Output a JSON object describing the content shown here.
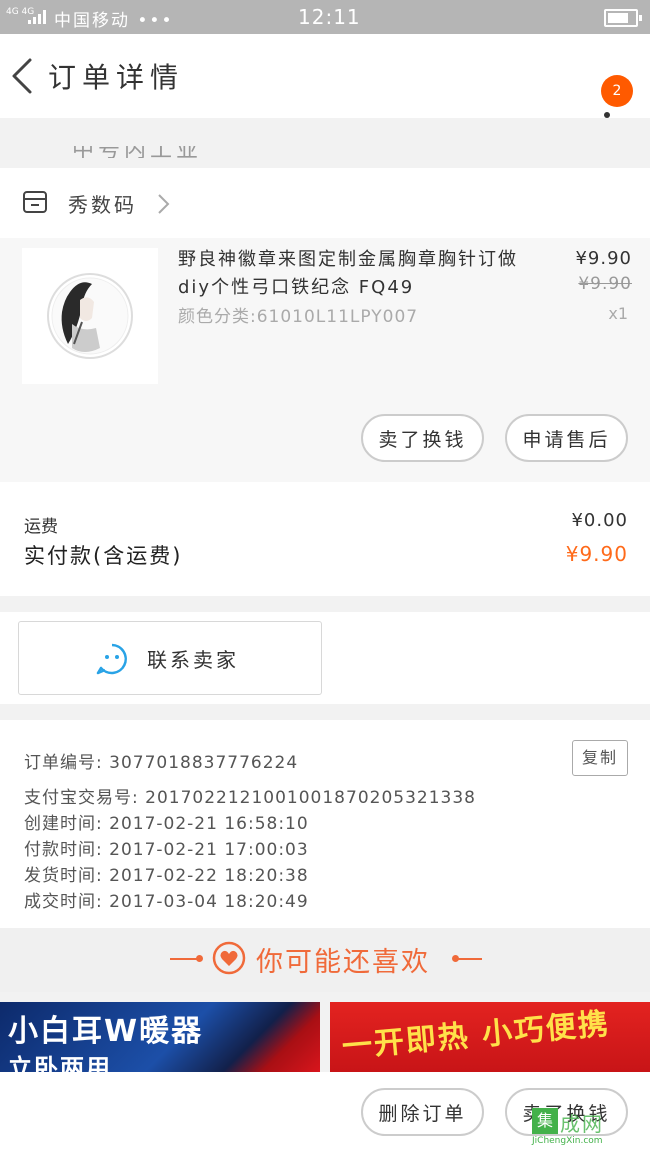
{
  "status_bar": {
    "network": "4G 4G",
    "carrier": "中国移动 •••",
    "time": "12:11"
  },
  "header": {
    "title": "订单详情",
    "badge_count": "2",
    "obscured_text": "中号内工业"
  },
  "store": {
    "name": "秀数码"
  },
  "product": {
    "title": "野良神徽章来图定制金属胸章胸针订做diy个性弓口铁纪念 FQ49",
    "variant": "颜色分类:61010L11LPY007",
    "price": "¥9.90",
    "original_price": "¥9.90",
    "quantity": "x1",
    "buttons": {
      "sell_swap": "卖了换钱",
      "after_sale": "申请售后"
    }
  },
  "totals": {
    "shipping_label": "运费",
    "shipping_value": "¥0.00",
    "paid_label": "实付款(含运费)",
    "paid_value": "¥9.90"
  },
  "contact": {
    "label": "联系卖家"
  },
  "order_info": {
    "order_no": "订单编号: 3077018837776224",
    "alipay_no": "支付宝交易号: 2017022121001001870205321338",
    "created": "创建时间: 2017-02-21 16:58:10",
    "paid": "付款时间: 2017-02-21 17:00:03",
    "shipped": "发货时间: 2017-02-22 18:20:38",
    "completed": "成交时间: 2017-03-04 18:20:49",
    "copy_label": "复制"
  },
  "recommend": {
    "title": "你可能还喜欢"
  },
  "banners": {
    "left_title": "小白耳W暖器",
    "left_sub": "立卧两用",
    "right_title": "一开即热 小巧便携"
  },
  "bottom_bar": {
    "delete_order": "删除订单",
    "sell_swap": "卖了换钱"
  },
  "watermark": {
    "box_char": "集",
    "text": "成网",
    "url": "JiChengXin.com"
  },
  "colors": {
    "accent_orange": "#ff6a1a",
    "badge": "#ff5a00",
    "contact_icon": "#29a3e6",
    "status_bar": "#b5b5b5"
  }
}
